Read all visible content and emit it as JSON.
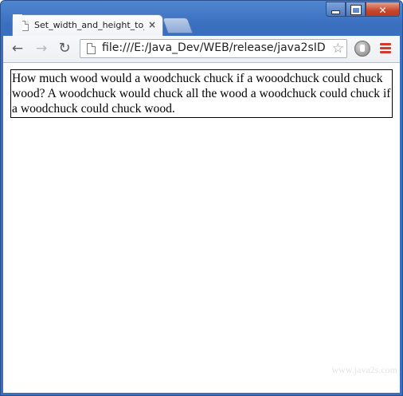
{
  "window": {
    "tab_title": "Set_width_and_height_to_",
    "tab_close_glyph": "×"
  },
  "window_controls": {
    "close_glyph": "✕"
  },
  "toolbar": {
    "back_glyph": "←",
    "forward_glyph": "→",
    "reload_glyph": "↻",
    "url": "file:///E:/Java_Dev/WEB/release/java2sID",
    "star_glyph": "☆"
  },
  "page": {
    "text": "How much wood would a woodchuck chuck if a wooodchuck could chuck wood? A woodchuck would chuck all the wood a woodchuck could chuck if a woodchuck could chuck wood.",
    "watermark": "www.java2s.com"
  },
  "icons": {
    "tab_page": "page-icon",
    "omnibox_page": "page-icon",
    "extension": "extension-icon",
    "menu": "menu-icon"
  },
  "colors": {
    "titlebar": "#3a6fbf",
    "close_button": "#c6472b",
    "menu_icon": "#d23b2b"
  }
}
